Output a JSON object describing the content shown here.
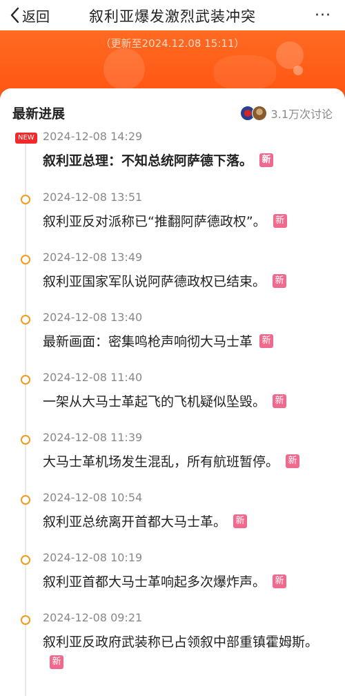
{
  "nav": {
    "back_label": "返回",
    "title": "叙利亚爆发激烈武装冲突",
    "more_label": "···"
  },
  "header": {
    "updated": "（更新至2024.12.08 15:11）"
  },
  "section": {
    "title": "最新进展",
    "discussion_count": "3.1万次讨论"
  },
  "badges": {
    "new_label": "NEW",
    "xin_label": "新"
  },
  "colors": {
    "brand_orange": "#ff5a14",
    "dot_orange": "#f39a1c",
    "new_red": "#f02a2a",
    "xin_pink": "#f06a8d"
  },
  "timeline": [
    {
      "time": "2024-12-08 14:29",
      "text": "叙利亚总理：不知总统阿萨德下落。",
      "is_new": true
    },
    {
      "time": "2024-12-08 13:51",
      "text": "叙利亚反对派称已“推翻阿萨德政权”。",
      "is_new": false
    },
    {
      "time": "2024-12-08 13:49",
      "text": "叙利亚国家军队说阿萨德政权已结束。",
      "is_new": false
    },
    {
      "time": "2024-12-08 13:40",
      "text": "最新画面：密集鸣枪声响彻大马士革",
      "is_new": false
    },
    {
      "time": "2024-12-08 11:40",
      "text": "一架从大马士革起飞的飞机疑似坠毁。",
      "is_new": false
    },
    {
      "time": "2024-12-08 11:39",
      "text": "大马士革机场发生混乱，所有航班暂停。",
      "is_new": false
    },
    {
      "time": "2024-12-08 10:54",
      "text": "叙利亚总统离开首都大马士革。",
      "is_new": false
    },
    {
      "time": "2024-12-08 10:19",
      "text": "叙利亚首都大马士革响起多次爆炸声。",
      "is_new": false
    },
    {
      "time": "2024-12-08 09:21",
      "text": "叙利亚反政府武装称已占领叙中部重镇霍姆斯。",
      "is_new": false
    }
  ]
}
